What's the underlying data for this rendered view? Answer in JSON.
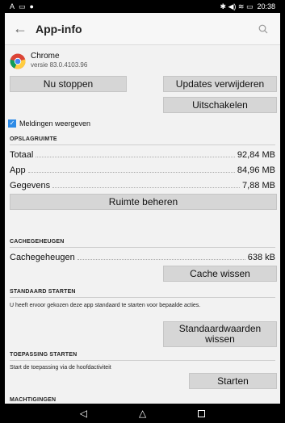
{
  "status_bar": {
    "left_icons": [
      "A",
      "▭",
      "●"
    ],
    "right_icons": "✱ ◀) ≋ ▭",
    "time": "20:38"
  },
  "app_bar": {
    "back_icon": "arrow-left-icon",
    "title": "App-info",
    "search_icon": "search-icon"
  },
  "app": {
    "name": "Chrome",
    "version": "versie 83.0.4103.96"
  },
  "buttons": {
    "stop": "Nu stoppen",
    "remove_updates": "Updates verwijderen",
    "disable": "Uitschakelen",
    "manage_space": "Ruimte beheren",
    "clear_cache": "Cache wissen",
    "clear_defaults_line1": "Standaardwaarden",
    "clear_defaults_line2": "wissen",
    "start": "Starten"
  },
  "notifications": {
    "checked": true,
    "label": "Meldingen weergeven"
  },
  "storage": {
    "title": "OPSLAGRUIMTE",
    "rows": [
      {
        "label": "Totaal",
        "value": "92,84 MB"
      },
      {
        "label": "App",
        "value": "84,96 MB"
      },
      {
        "label": "Gegevens",
        "value": "7,88 MB"
      }
    ]
  },
  "cache": {
    "title": "CACHEGEHEUGEN",
    "label": "Cachegeheugen",
    "value": "638 kB"
  },
  "default_start": {
    "title": "STANDAARD STARTEN",
    "description": "U heeft ervoor gekozen deze app standaard te starten voor bepaalde acties."
  },
  "app_start": {
    "title": "TOEPASSING STARTEN",
    "description": "Start de toepassing via de hoofdactiviteit"
  },
  "permissions": {
    "title": "MACHTIGINGEN"
  },
  "nav_bar": {
    "back": "◁",
    "home": "△"
  },
  "colors": {
    "accent": "#2e8be6",
    "button_bg": "#d6d6d6",
    "background": "#f2f2f2"
  }
}
